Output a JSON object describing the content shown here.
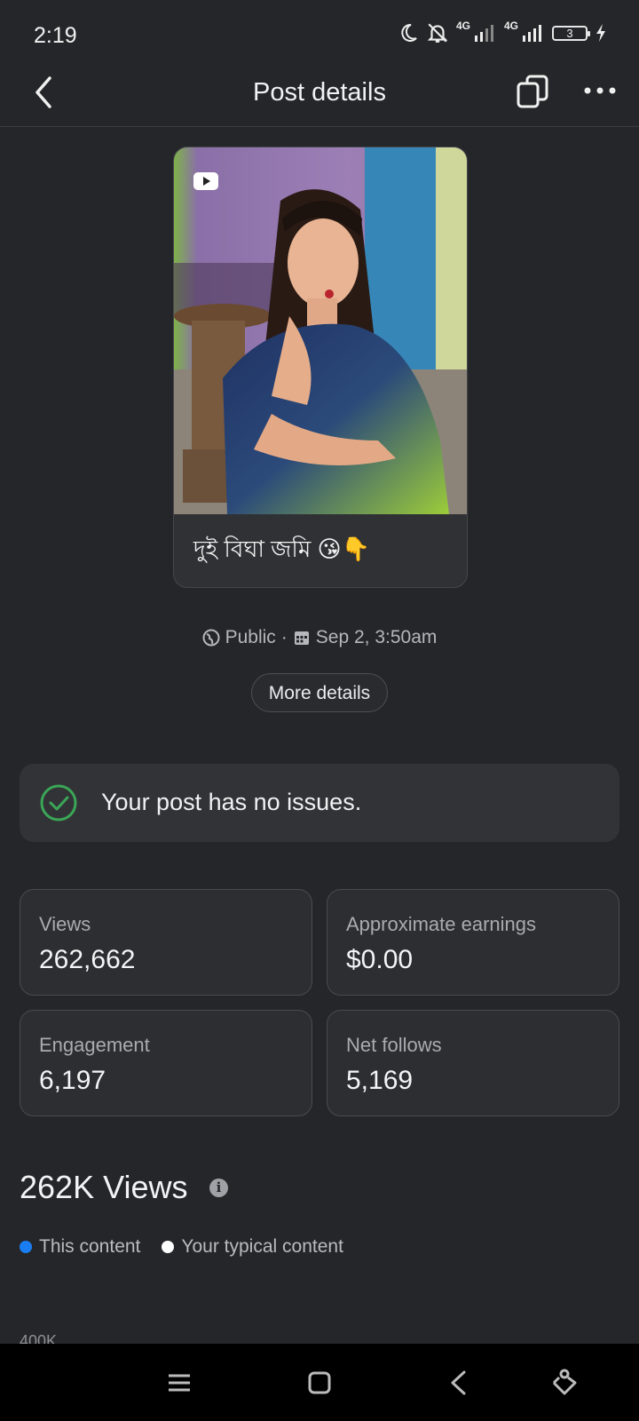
{
  "status_bar": {
    "time": "2:19",
    "network_1": "4G",
    "network_2": "4G",
    "battery": "3",
    "icons": [
      "moon-icon",
      "bell-off-icon",
      "signal-icon",
      "signal-icon",
      "battery-icon",
      "charging-icon"
    ]
  },
  "app_bar": {
    "title": "Post details",
    "icons": [
      "back-arrow-icon",
      "copy-icon",
      "more-icon"
    ]
  },
  "post": {
    "caption": "দুই বিঘা জমি 😘👇",
    "media_type_icon": "youtube-icon",
    "visibility": "Public",
    "separator": "·",
    "date": "Sep 2, 3:50am",
    "more_details_label": "More details"
  },
  "issues": {
    "text": "Your post has no issues.",
    "icon": "check-circle-icon",
    "color": "#3aa657"
  },
  "stats": [
    {
      "label": "Views",
      "value": "262,662"
    },
    {
      "label": "Approximate earnings",
      "value": "$0.00"
    },
    {
      "label": "Engagement",
      "value": "6,197"
    },
    {
      "label": "Net follows",
      "value": "5,169"
    }
  ],
  "views_section": {
    "heading": "262K Views",
    "legend": [
      {
        "label": "This content",
        "color": "#1a7ef2"
      },
      {
        "label": "Your typical content",
        "color": "#ffffff"
      }
    ],
    "axis_tick": "400K"
  },
  "nav_bar": {
    "icons": [
      "menu-icon",
      "home-square-icon",
      "back-chevron-icon",
      "assistant-icon"
    ]
  }
}
